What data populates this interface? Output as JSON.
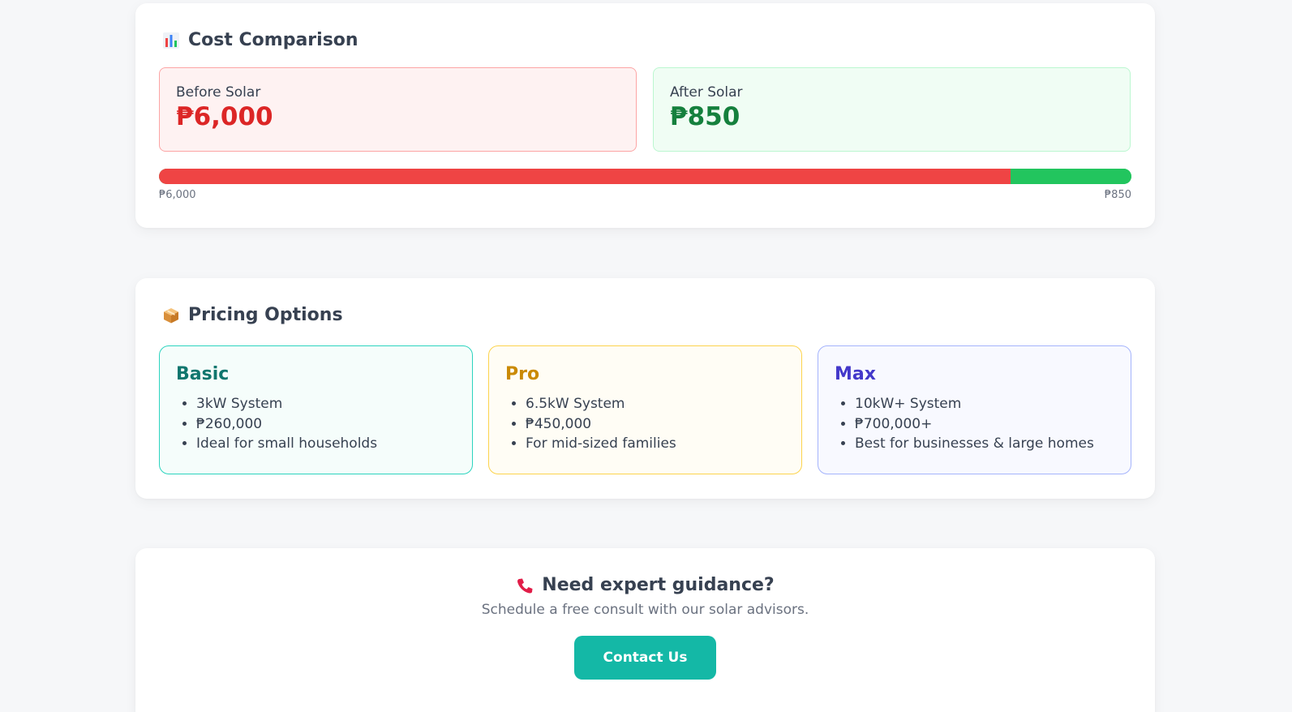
{
  "cost_comparison": {
    "title": "Cost Comparison",
    "icon": "bar-chart-icon",
    "before_label": "Before Solar",
    "before_value": "₱6,000",
    "after_label": "After Solar",
    "after_value": "₱850",
    "bar": {
      "before_amount": 6000,
      "after_amount": 850,
      "before_color": "#ef4444",
      "after_color": "#22c55e"
    },
    "bar_left_label": "₱6,000",
    "bar_right_label": "₱850"
  },
  "pricing": {
    "title": "Pricing Options",
    "icon": "package-icon",
    "plans": [
      {
        "name": "Basic",
        "color": "#0f766e",
        "features": [
          "3kW System",
          "₱260,000",
          "Ideal for small households"
        ]
      },
      {
        "name": "Pro",
        "color": "#ca8a04",
        "features": [
          "6.5kW System",
          "₱450,000",
          "For mid-sized families"
        ]
      },
      {
        "name": "Max",
        "color": "#4338ca",
        "features": [
          "10kW+ System",
          "₱700,000+",
          "Best for businesses & large homes"
        ]
      }
    ]
  },
  "contact": {
    "icon": "phone-icon",
    "title": "Need expert guidance?",
    "subtitle": "Schedule a free consult with our solar advisors.",
    "button_label": "Contact Us",
    "button_color": "#14b8a6"
  }
}
